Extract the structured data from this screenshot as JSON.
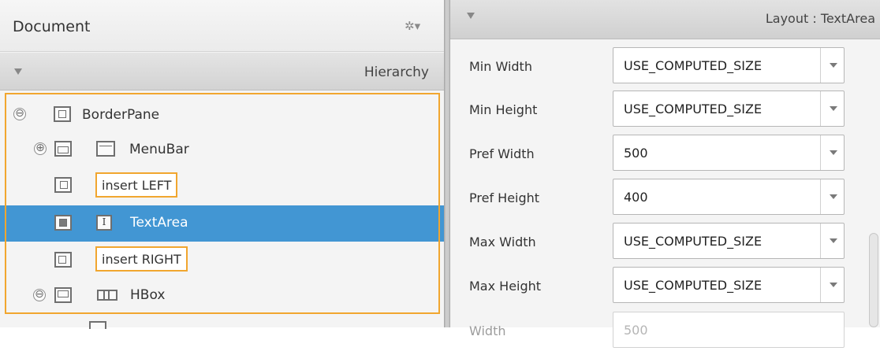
{
  "document_panel": {
    "title": "Document",
    "gear_icon": "gear-dropdown-icon",
    "gear_glyph": "✲▾",
    "hierarchy_title": "Hierarchy"
  },
  "hierarchy": [
    {
      "label": "BorderPane",
      "expander": "⊖",
      "type": "borderpane"
    },
    {
      "label": "MenuBar",
      "expander": "⊕",
      "type": "menubar"
    },
    {
      "label": "insert LEFT",
      "type": "insert-left"
    },
    {
      "label": "TextArea",
      "type": "textarea",
      "selected": true
    },
    {
      "label": "insert RIGHT",
      "type": "insert-right"
    },
    {
      "label": "HBox",
      "expander": "⊖",
      "type": "hbox"
    }
  ],
  "layout_panel": {
    "title": "Layout : TextArea",
    "properties": [
      {
        "label": "Min Width",
        "value": "USE_COMPUTED_SIZE"
      },
      {
        "label": "Min Height",
        "value": "USE_COMPUTED_SIZE"
      },
      {
        "label": "Pref Width",
        "value": "500"
      },
      {
        "label": "Pref Height",
        "value": "400"
      },
      {
        "label": "Max Width",
        "value": "USE_COMPUTED_SIZE"
      },
      {
        "label": "Max Height",
        "value": "USE_COMPUTED_SIZE"
      },
      {
        "label": "Width",
        "value": "500",
        "disabled": true
      }
    ]
  },
  "colors": {
    "selection": "#4296d3",
    "accent_outline": "#f1a62f"
  }
}
